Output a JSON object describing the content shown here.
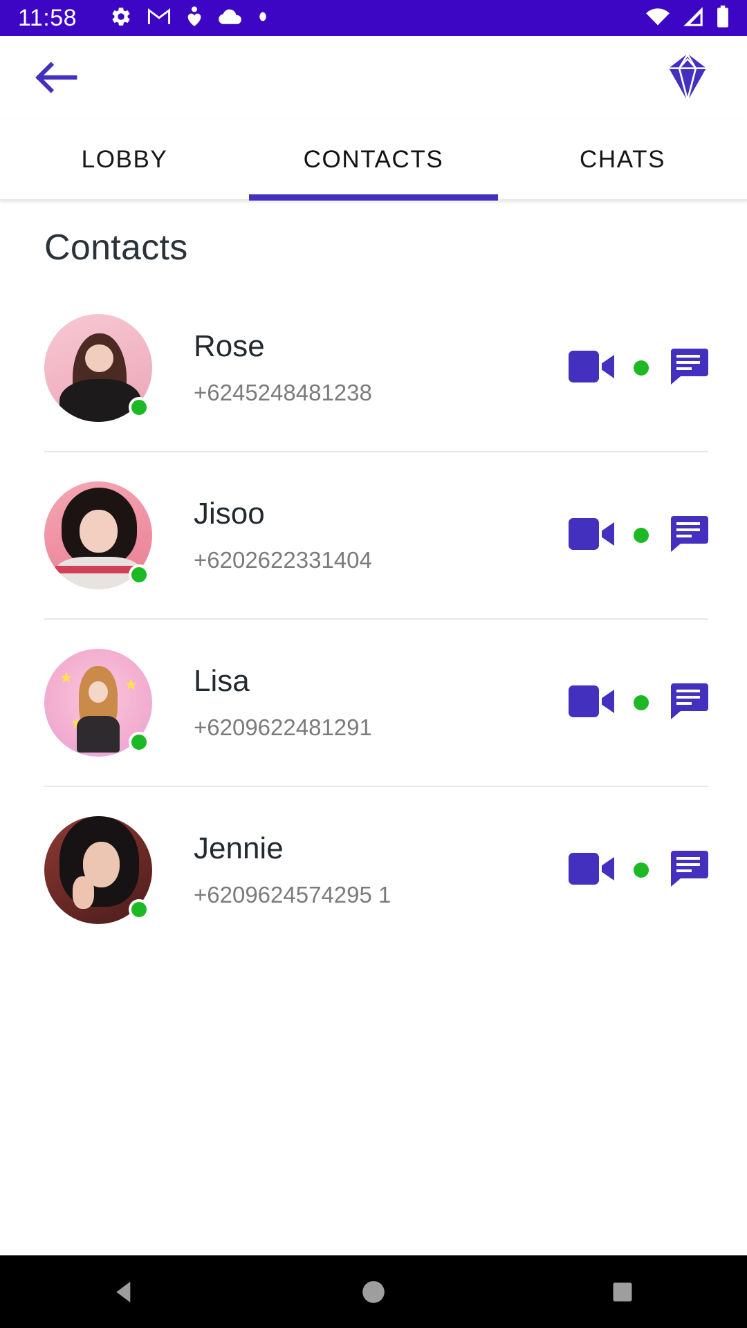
{
  "status_bar": {
    "time": "11:58",
    "left_icons": [
      "gear-icon",
      "gmail-icon",
      "heart-person-icon",
      "cloud-icon",
      "dot-icon"
    ],
    "right_icons": [
      "wifi-icon",
      "cellular-signal-icon",
      "battery-icon"
    ],
    "background_color": "#3d06c4"
  },
  "app_bar": {
    "back_icon": "back-arrow-icon",
    "logo_icon": "diamond-gem-icon",
    "accent_color": "#4430bf"
  },
  "tabs": [
    {
      "label": "LOBBY",
      "active": false
    },
    {
      "label": "CONTACTS",
      "active": true
    },
    {
      "label": "CHATS",
      "active": false
    }
  ],
  "main": {
    "title": "Contacts",
    "accent_color": "#4430bf",
    "online_color": "#1db924",
    "contacts": [
      {
        "name": "Rose",
        "phone": "+6245248481238",
        "online": true,
        "avatar": "rose-avatar",
        "video_icon": "video-call-icon",
        "chat_icon": "chat-bubble-icon",
        "status_icon": "online-dot-icon"
      },
      {
        "name": "Jisoo",
        "phone": "+6202622331404",
        "online": true,
        "avatar": "jisoo-avatar",
        "video_icon": "video-call-icon",
        "chat_icon": "chat-bubble-icon",
        "status_icon": "online-dot-icon"
      },
      {
        "name": "Lisa",
        "phone": "+6209622481291",
        "online": true,
        "avatar": "lisa-avatar",
        "video_icon": "video-call-icon",
        "chat_icon": "chat-bubble-icon",
        "status_icon": "online-dot-icon"
      },
      {
        "name": "Jennie",
        "phone": "+6209624574295 1",
        "online": true,
        "avatar": "jennie-avatar",
        "video_icon": "video-call-icon",
        "chat_icon": "chat-bubble-icon",
        "status_icon": "online-dot-icon"
      }
    ]
  },
  "nav_bar": {
    "back_icon": "nav-back-triangle-icon",
    "home_icon": "nav-home-circle-icon",
    "recents_icon": "nav-recents-square-icon"
  }
}
